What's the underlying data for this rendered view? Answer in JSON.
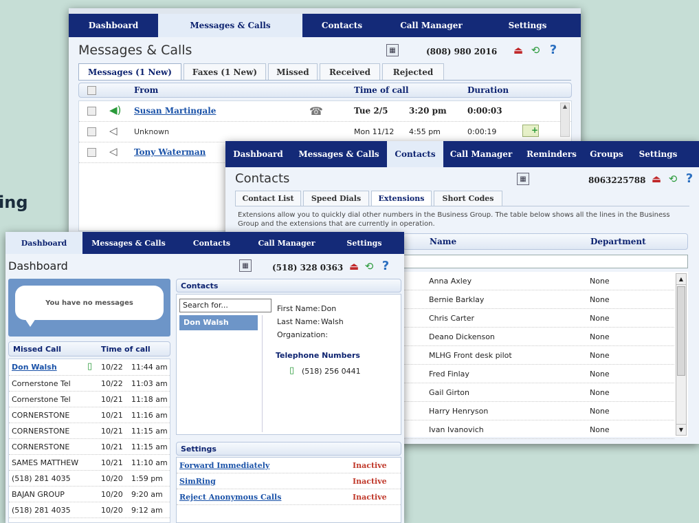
{
  "background_text": "ing",
  "colors": {
    "nav": "#142a78",
    "active_tab": "#e3ecf8",
    "link": "#1a52a8",
    "inactive": "#c0392b"
  },
  "messages_window": {
    "nav": [
      "Dashboard",
      "Messages & Calls",
      "Contacts",
      "Call Manager",
      "Settings"
    ],
    "title": "Messages & Calls",
    "phone": "(808) 980 2016",
    "tabs": [
      "Messages (1 New)",
      "Faxes (1 New)",
      "Missed",
      "Received",
      "Rejected"
    ],
    "columns": {
      "from": "From",
      "time": "Time of call",
      "duration": "Duration"
    },
    "rows": [
      {
        "from": "Susan Martingale",
        "date": "Tue 2/5",
        "time": "3:20 pm",
        "duration": "0:00:03"
      },
      {
        "from": "Unknown",
        "date": "Mon 11/12",
        "time": "4:55 pm",
        "duration": "0:00:19"
      },
      {
        "from": "Tony Waterman"
      }
    ]
  },
  "contacts_window": {
    "nav": [
      "Dashboard",
      "Messages & Calls",
      "Contacts",
      "Call Manager",
      "Reminders",
      "Groups",
      "Settings"
    ],
    "title": "Contacts",
    "phone": "8063225788",
    "tabs": [
      "Contact List",
      "Speed Dials",
      "Extensions",
      "Short Codes"
    ],
    "description": "Extensions allow you to quickly dial other numbers in the Business Group. The table below shows all the lines in the Business Group and the extensions that are currently in operation.",
    "columns": {
      "name": "Name",
      "department": "Department"
    },
    "rows": [
      {
        "name": "Anna Axley",
        "dept": "None"
      },
      {
        "name": "Bernie Barklay",
        "dept": "None"
      },
      {
        "name": "Chris Carter",
        "dept": "None"
      },
      {
        "name": "Deano Dickenson",
        "dept": "None"
      },
      {
        "name": "MLHG Front desk pilot",
        "dept": "None"
      },
      {
        "name": "Fred Finlay",
        "dept": "None"
      },
      {
        "name": "Gail Girton",
        "dept": "None"
      },
      {
        "name": "Harry Henryson",
        "dept": "None"
      },
      {
        "name": "Ivan Ivanovich",
        "dept": "None"
      }
    ]
  },
  "dashboard_window": {
    "nav": [
      "Dashboard",
      "Messages & Calls",
      "Contacts",
      "Call Manager",
      "Settings"
    ],
    "title": "Dashboard",
    "phone": "(518) 328 0363",
    "no_messages": "You have no messages",
    "missed_header": {
      "caller": "Missed Call",
      "time": "Time of call"
    },
    "missed": [
      {
        "caller": "Don Walsh",
        "date": "10/22",
        "time": "11:44 am"
      },
      {
        "caller": "Cornerstone Tel",
        "date": "10/22",
        "time": "11:03 am"
      },
      {
        "caller": "Cornerstone Tel",
        "date": "10/21",
        "time": "11:18 am"
      },
      {
        "caller": "CORNERSTONE",
        "date": "10/21",
        "time": "11:16 am"
      },
      {
        "caller": "CORNERSTONE",
        "date": "10/21",
        "time": "11:15 am"
      },
      {
        "caller": "CORNERSTONE",
        "date": "10/21",
        "time": "11:15 am"
      },
      {
        "caller": "SAMES MATTHEW",
        "date": "10/21",
        "time": "11:10 am"
      },
      {
        "caller": "(518) 281 4035",
        "date": "10/20",
        "time": "1:59 pm"
      },
      {
        "caller": "BAJAN GROUP",
        "date": "10/20",
        "time": "9:20 am"
      },
      {
        "caller": "(518) 281 4035",
        "date": "10/20",
        "time": "9:12 am"
      }
    ],
    "contacts": {
      "title": "Contacts",
      "search_value": "Search for...",
      "selected": "Don Walsh",
      "first_label": "First Name:",
      "first": "Don",
      "last_label": "Last Name:",
      "last": "Walsh",
      "org_label": "Organization:",
      "tel_title": "Telephone Numbers",
      "tel": "(518) 256 0441"
    },
    "settings": {
      "title": "Settings",
      "items": [
        {
          "label": "Forward Immediately",
          "status": "Inactive"
        },
        {
          "label": "SimRing",
          "status": "Inactive"
        },
        {
          "label": "Reject Anonymous Calls",
          "status": "Inactive"
        }
      ]
    }
  }
}
